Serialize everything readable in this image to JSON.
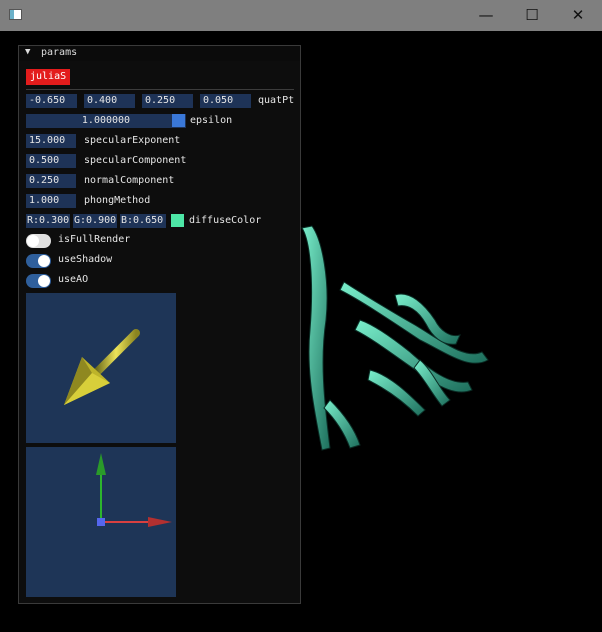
{
  "window": {
    "min_glyph": "—",
    "max_glyph": "☐",
    "close_glyph": "✕"
  },
  "panel": {
    "header": {
      "arrow": "▼",
      "title": "params"
    },
    "julia_button": "juliaS",
    "quatPt": {
      "values": [
        "-0.650",
        "0.400",
        "0.250",
        "0.050"
      ],
      "label": "quatPt"
    },
    "epsilon": {
      "value": "1.000000",
      "label": "epsilon",
      "color": "#3a78d8"
    },
    "specularExponent": {
      "value": "15.000",
      "label": "specularExponent"
    },
    "specularComponent": {
      "value": "0.500",
      "label": "specularComponent"
    },
    "normalComponent": {
      "value": "0.250",
      "label": "normalComponent"
    },
    "phongMethod": {
      "value": "1.000",
      "label": "phongMethod"
    },
    "diffuseColor": {
      "r": "R:0.300",
      "g": "G:0.900",
      "b": "B:0.650",
      "label": "diffuseColor",
      "color": "#4de6a6"
    },
    "toggles": [
      {
        "label": "isFullRender",
        "on": false
      },
      {
        "label": "useShadow",
        "on": true
      },
      {
        "label": "useAO",
        "on": true
      }
    ]
  },
  "colors": {
    "field_bg": "#1e3357",
    "button_red": "#e31c1c",
    "toggle_on": "#2f5f9c",
    "toggle_off": "#e0e0e0",
    "fractal": "#4fd6b0"
  }
}
